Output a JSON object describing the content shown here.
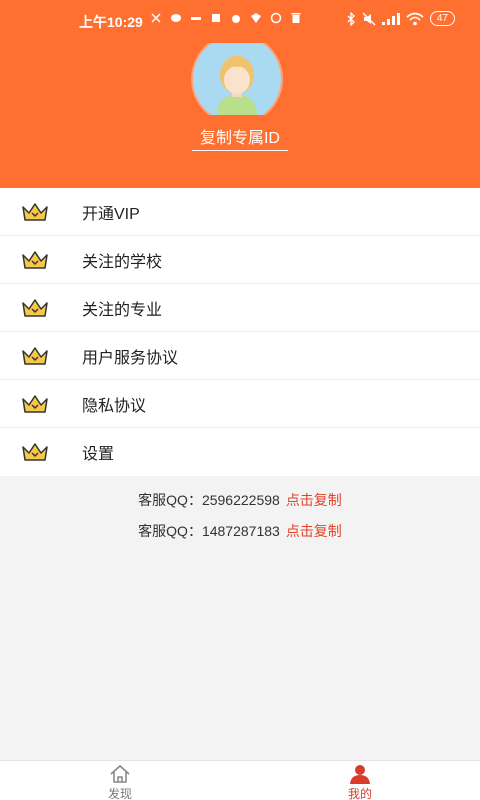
{
  "status_bar": {
    "time": "上午10:29",
    "battery": "47"
  },
  "profile": {
    "copy_id_label": "复制专属ID"
  },
  "menu": [
    {
      "label": "开通VIP"
    },
    {
      "label": "关注的学校"
    },
    {
      "label": "关注的专业"
    },
    {
      "label": "用户服务协议"
    },
    {
      "label": "隐私协议"
    },
    {
      "label": "设置"
    }
  ],
  "contacts": [
    {
      "text": "客服QQ：2596222598",
      "action": "点击复制"
    },
    {
      "text": "客服QQ：1487287183",
      "action": "点击复制"
    }
  ],
  "tabbar": {
    "discover": "发现",
    "mine": "我的"
  },
  "colors": {
    "header": "#ff7030",
    "accent": "#e0452a",
    "crown": "#f6c84a"
  }
}
